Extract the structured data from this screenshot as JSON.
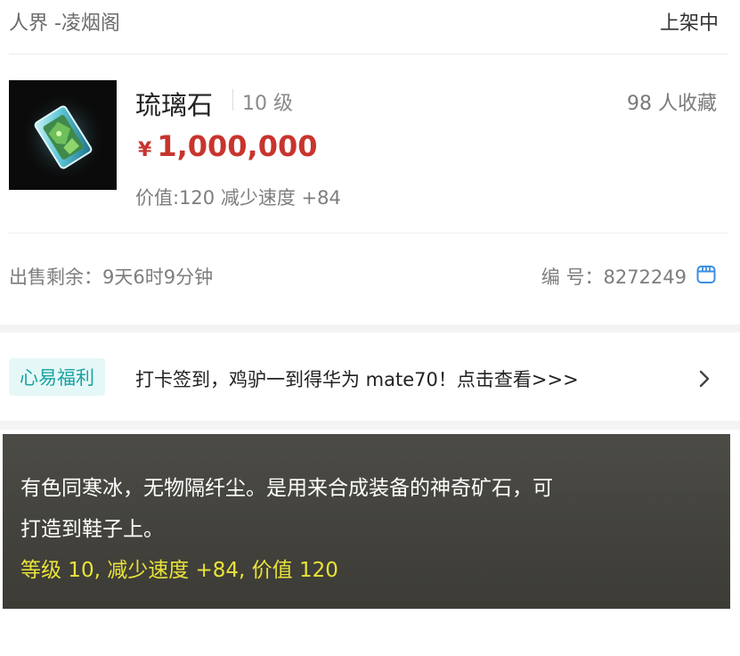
{
  "header": {
    "server": "人界 -凌烟阁",
    "status": "上架中"
  },
  "item": {
    "image_icon": "green-crystal-gem-icon",
    "name": "琉璃石",
    "level": "10 级",
    "favorites": "98 人收藏",
    "price_symbol": "¥",
    "price": "1,000,000",
    "attributes": "价值:120 减少速度 +84"
  },
  "sale": {
    "remaining": "出售剩余：9天6时9分钟",
    "serial": "编  号：8272249",
    "copy_icon": "copy-icon"
  },
  "promo": {
    "badge": "心易福利",
    "text": "打卡签到，鸡驴一到得华为 mate70！点击查看>>>",
    "arrow_icon": "chevron-right-icon"
  },
  "description": {
    "lines": [
      "有色同寒冰，无物隔纤尘。是用来合成装备的神奇矿石，可",
      "打造到鞋子上。"
    ],
    "stats": "等级 10, 减少速度 +84, 价值 120"
  },
  "colors": {
    "price": "#c8342e",
    "promo_badge": "#1aa3a3",
    "stats": "#e9e33a",
    "copy_icon": "#3a8ee6"
  }
}
